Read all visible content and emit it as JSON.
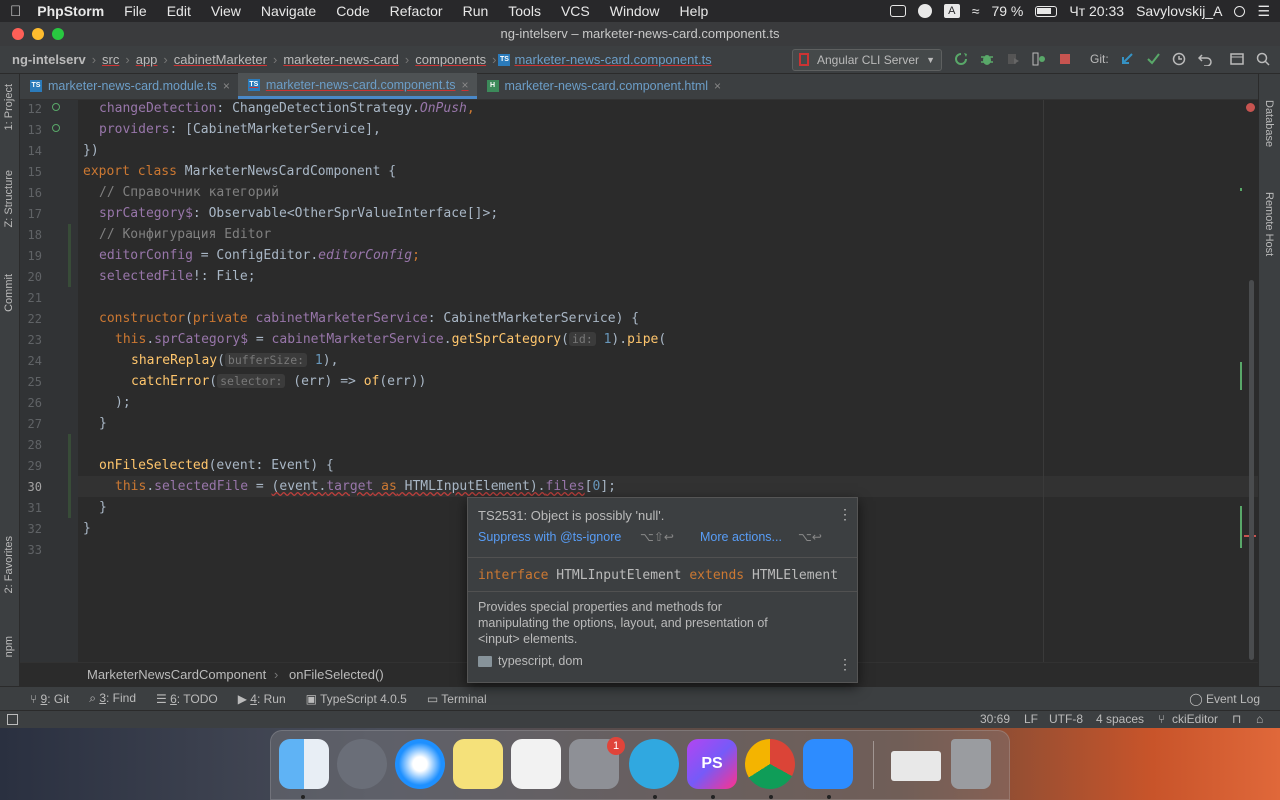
{
  "menubar": {
    "app": "PhpStorm",
    "items": [
      "File",
      "Edit",
      "View",
      "Navigate",
      "Code",
      "Refactor",
      "Run",
      "Tools",
      "VCS",
      "Window",
      "Help"
    ],
    "battery": "79 %",
    "clock": "Чт 20:33",
    "user": "Savylovskij_A"
  },
  "window": {
    "title": "ng-intelserv – marketer-news-card.component.ts"
  },
  "navbar": {
    "crumbs": [
      "ng-intelserv",
      "src",
      "app",
      "cabinetMarketer",
      "marketer-news-card",
      "components",
      "marketer-news-card.component.ts"
    ],
    "run_config": "Angular CLI Server",
    "git_label": "Git:"
  },
  "tabs": [
    {
      "label": "marketer-news-card.module.ts",
      "active": false
    },
    {
      "label": "marketer-news-card.component.ts",
      "active": true
    },
    {
      "label": "marketer-news-card.component.html",
      "active": false
    }
  ],
  "left_tools": [
    "1: Project",
    "Z: Structure",
    "Commit",
    "2: Favorites",
    "npm"
  ],
  "right_tools": [
    "Database",
    "Remote Host"
  ],
  "lines": [
    "12",
    "13",
    "14",
    "15",
    "16",
    "17",
    "18",
    "19",
    "20",
    "21",
    "22",
    "23",
    "24",
    "25",
    "26",
    "27",
    "28",
    "29",
    "30",
    "31",
    "32",
    "33"
  ],
  "current_line": "30",
  "code_text": {
    "l12": [
      "changeDetection",
      ": ",
      "ChangeDetectionStrategy",
      ".",
      "OnPush",
      ","
    ],
    "l13": [
      "providers",
      ": [",
      "CabinetMarketerService",
      "],"
    ],
    "l14": "})",
    "l15": [
      "export class ",
      "MarketerNewsCardComponent",
      " {"
    ],
    "l16": "// Справочник категорий",
    "l17": [
      "sprCategory$",
      ": Observable<OtherSprValueInterface[]>;"
    ],
    "l18": "// Конфигурация Editor",
    "l19": [
      "editorConfig",
      " = ConfigEditor.",
      "editorConfig",
      ";"
    ],
    "l20": [
      "selectedFile",
      "!: File;"
    ],
    "l22": [
      "constructor",
      "(",
      "private ",
      "cabinetMarketerService",
      ": CabinetMarketerService) {"
    ],
    "l23": [
      "this",
      ".",
      "sprCategory$",
      " = ",
      "cabinetMarketerService",
      ".",
      "getSprCategory",
      "(",
      "id:",
      " 1",
      ").",
      "pipe",
      "("
    ],
    "l24": [
      "shareReplay",
      "(",
      "bufferSize:",
      " 1",
      "),"
    ],
    "l25": [
      "catchError",
      "(",
      "selector:",
      " (err) => ",
      "of",
      "(err))"
    ],
    "l26": ");",
    "l27": "}",
    "l29": [
      "onFileSelected",
      "(event: Event) {"
    ],
    "l30": [
      "this",
      ".",
      "selectedFile",
      " = ",
      "(event.",
      "target",
      " as",
      " HTMLInputElement",
      ").",
      "files",
      "[",
      "0",
      "];"
    ],
    "l31": "}",
    "l32": "}"
  },
  "bottom_breadcrumb": [
    "MarketerNewsCardComponent",
    "onFileSelected()"
  ],
  "popup": {
    "error": "TS2531: Object is possibly 'null'.",
    "action1": "Suppress with @ts-ignore",
    "action1_keys": "⌥⇧↩",
    "action2": "More actions...",
    "action2_keys": "⌥↩",
    "sig_kw1": "interface",
    "sig_name": "HTMLInputElement",
    "sig_kw2": "extends",
    "sig_base": "HTMLElement",
    "doc_line1": "Provides special properties and methods for",
    "doc_line2": "manipulating the options, layout, and presentation of",
    "doc_line3": "<input> elements.",
    "lib": "typescript, dom"
  },
  "toolwindows": [
    {
      "num": "9",
      "label": ": Git"
    },
    {
      "num": "3",
      "label": ": Find"
    },
    {
      "num": "6",
      "label": ": TODO"
    },
    {
      "num": "4",
      "label": ": Run"
    },
    {
      "num": "",
      "label": "TypeScript 4.0.5"
    },
    {
      "num": "",
      "label": "Terminal"
    }
  ],
  "event_log": "Event Log",
  "status": {
    "position": "30:69",
    "line_sep": "LF",
    "encoding": "UTF-8",
    "indent": "4 spaces",
    "branch": "ckiEditor"
  },
  "dock_badge": "1",
  "dock_apps": [
    "finder-icon",
    "launchpad-icon",
    "safari-icon",
    "notes-icon",
    "numbers-icon",
    "system-preferences-icon",
    "telegram-icon",
    "phpstorm-icon",
    "chrome-icon",
    "zoom-icon",
    "chrome-window-icon",
    "trash-icon"
  ]
}
